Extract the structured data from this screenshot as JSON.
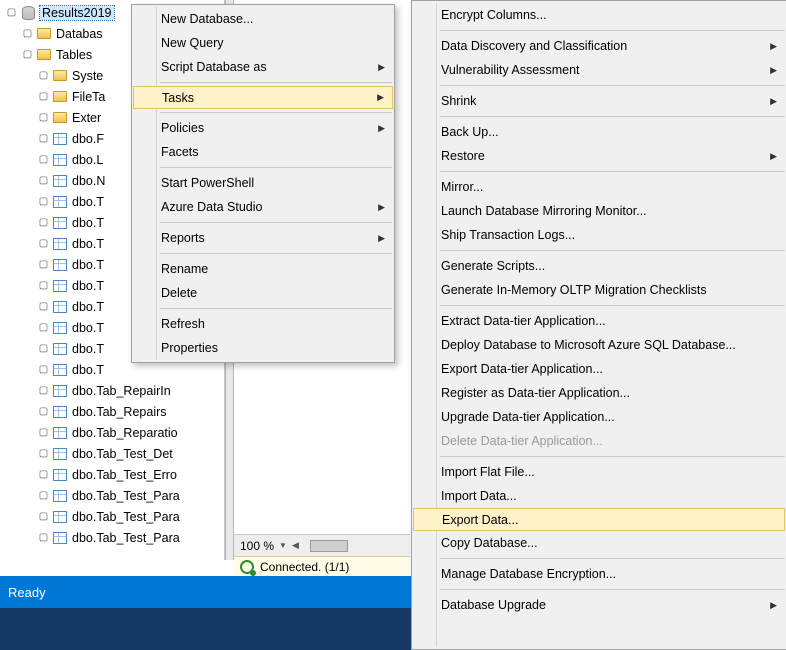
{
  "tree": {
    "db_name": "Results2019",
    "folders": [
      "Databas",
      "Tables"
    ],
    "sub": [
      "Syste",
      "FileTa",
      "Exter"
    ],
    "tables": [
      "dbo.F",
      "dbo.L",
      "dbo.N",
      "dbo.T",
      "dbo.T",
      "dbo.T",
      "dbo.T",
      "dbo.T",
      "dbo.T",
      "dbo.T",
      "dbo.T",
      "dbo.T",
      "dbo.Tab_RepairIn",
      "dbo.Tab_Repairs",
      "dbo.Tab_Reparatio",
      "dbo.Tab_Test_Det",
      "dbo.Tab_Test_Erro",
      "dbo.Tab_Test_Para",
      "dbo.Tab_Test_Para",
      "dbo.Tab_Test_Para"
    ]
  },
  "zoom": {
    "value": "100 %"
  },
  "connection": {
    "text": "Connected. (1/1)"
  },
  "status": {
    "text": "Ready"
  },
  "menu1": {
    "new_database": "New Database...",
    "new_query": "New Query",
    "script_database_as": "Script Database as",
    "tasks": "Tasks",
    "policies": "Policies",
    "facets": "Facets",
    "start_powershell": "Start PowerShell",
    "azure_data_studio": "Azure Data Studio",
    "reports": "Reports",
    "rename": "Rename",
    "delete": "Delete",
    "refresh": "Refresh",
    "properties": "Properties"
  },
  "menu2": {
    "encrypt_columns": "Encrypt Columns...",
    "data_discovery": "Data Discovery and Classification",
    "vulnerability_assessment": "Vulnerability Assessment",
    "shrink": "Shrink",
    "back_up": "Back Up...",
    "restore": "Restore",
    "mirror": "Mirror...",
    "launch_mirror_monitor": "Launch Database Mirroring Monitor...",
    "ship_logs": "Ship Transaction Logs...",
    "generate_scripts": "Generate Scripts...",
    "generate_oltp": "Generate In-Memory OLTP Migration Checklists",
    "extract_dac": "Extract Data-tier Application...",
    "deploy_azure": "Deploy Database to Microsoft Azure SQL Database...",
    "export_dac": "Export Data-tier Application...",
    "register_dac": "Register as Data-tier Application...",
    "upgrade_dac": "Upgrade Data-tier Application...",
    "delete_dac": "Delete Data-tier Application...",
    "import_flat": "Import Flat File...",
    "import_data": "Import Data...",
    "export_data": "Export Data...",
    "copy_database": "Copy Database...",
    "manage_encryption": "Manage Database Encryption...",
    "database_upgrade": "Database Upgrade"
  }
}
